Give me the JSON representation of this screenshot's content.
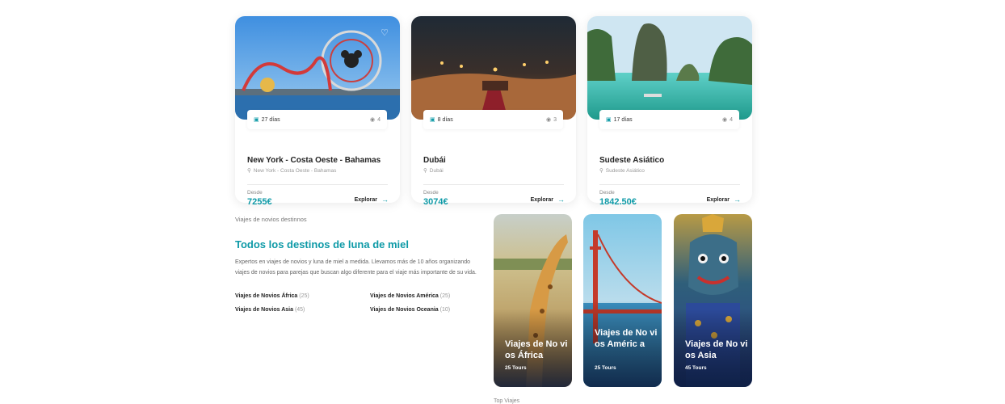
{
  "cards": [
    {
      "days": "27 días",
      "photos": "4",
      "title": "New York - Costa Oeste - Bahamas",
      "location": "New York - Costa Oeste - Bahamas",
      "price_label": "Desde",
      "price": "7255€",
      "cta": "Explorar"
    },
    {
      "days": "8 días",
      "photos": "3",
      "title": "Dubái",
      "location": "Dubái",
      "price_label": "Desde",
      "price": "3074€",
      "cta": "Explorar"
    },
    {
      "days": "17 días",
      "photos": "4",
      "title": "Sudeste Asiático",
      "location": "Sudeste Asiático",
      "price_label": "Desde",
      "price": "1842.50€",
      "cta": "Explorar"
    }
  ],
  "honeymoon": {
    "label": "Viajes de novios destinnos",
    "title": "Todos los destinos de luna de miel",
    "description": "Expertos en viajes de novios y luna de miel a medida. Llevamos más de 10 años organizando viajes de novios para parejas que buscan algo diferente para el viaje más importante de su vida.",
    "links": [
      {
        "name": "Viajes de Novios África",
        "count": "(25)"
      },
      {
        "name": "Viajes de Novios América",
        "count": "(25)"
      },
      {
        "name": "Viajes de Novios Asia",
        "count": "(45)"
      },
      {
        "name": "Viajes de Novios Oceania",
        "count": "(10)"
      }
    ]
  },
  "destinations": [
    {
      "name": "Viajes de No vios África",
      "tours": "25 Tours"
    },
    {
      "name": "Viajes de No vios Améric a",
      "tours": "25 Tours"
    },
    {
      "name": "Viajes de No vios Asia",
      "tours": "45 Tours"
    }
  ],
  "footer_label": "Top Viajes",
  "colors": {
    "accent": "#0e9aa7"
  }
}
